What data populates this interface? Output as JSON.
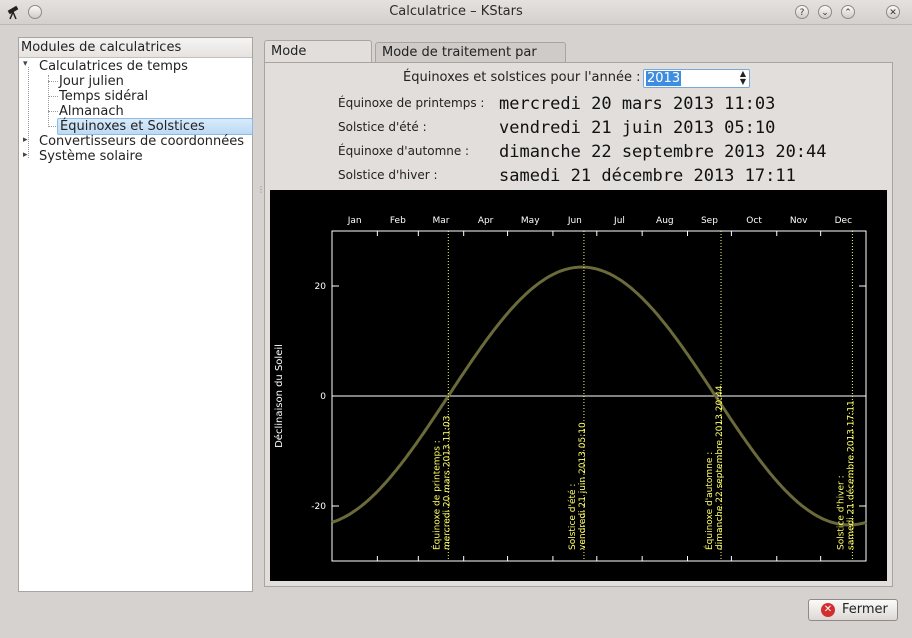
{
  "window": {
    "title": "Calculatrice – KStars",
    "buttons": {
      "help": "?",
      "minimize": "⌄",
      "maximize": "⌃",
      "close": "✕"
    }
  },
  "left_panel": {
    "header": "Modules de calculatrices",
    "tree": {
      "time_group": "Calculatrices de temps",
      "julian": "Jour julien",
      "sidereal": "Temps sidéral",
      "almanac": "Almanach",
      "equinox": "Équinoxes et Solstices",
      "coord_group": "Convertisseurs de coordonnées",
      "solar_group": "Système solaire"
    }
  },
  "tabs": {
    "interactive": "Mode interactif",
    "batch": "Mode de traitement par lots"
  },
  "form": {
    "year_label": "Équinoxes et solstices pour l'année :",
    "year_value": "2013",
    "rows": [
      {
        "label": "Équinoxe de printemps :",
        "value": "mercredi 20 mars 2013 11:03"
      },
      {
        "label": "Solstice d'été :",
        "value": "vendredi 21 juin 2013 05:10"
      },
      {
        "label": "Équinoxe d'automne :",
        "value": "dimanche 22 septembre 2013 20:44"
      },
      {
        "label": "Solstice d'hiver :",
        "value": "samedi 21 décembre 2013 17:11"
      }
    ]
  },
  "chart_data": {
    "type": "line",
    "title": "",
    "xlabel": "",
    "ylabel": "Déclinaison du Soleil",
    "month_labels": [
      "Jan",
      "Feb",
      "Mar",
      "Apr",
      "May",
      "Jun",
      "Jul",
      "Aug",
      "Sep",
      "Oct",
      "Nov",
      "Dec"
    ],
    "xlim": [
      0,
      365
    ],
    "ylim": [
      -30,
      30
    ],
    "yticks": [
      -20,
      0,
      20
    ],
    "series": [
      {
        "amplitude": 23.44,
        "color": "#6b6a3a"
      }
    ],
    "markers": [
      {
        "day": 79.5,
        "label1": "Équinoxe de printemps :",
        "label2": "mercredi 20 mars 2013 11:03"
      },
      {
        "day": 172.2,
        "label1": "Solstice d'été :",
        "label2": "vendredi 21 juin 2013 05:10"
      },
      {
        "day": 265.9,
        "label1": "Équinoxe d'automne :",
        "label2": "dimanche 22 septembre 2013 20:44"
      },
      {
        "day": 355.7,
        "label1": "Solstice d'hiver :",
        "label2": "samedi 21 décembre 2013 17:11"
      }
    ],
    "colors": {
      "background": "#000000",
      "axes": "#ffffff",
      "curve": "#6b6a3a",
      "marker": "#ffff66"
    }
  },
  "footer": {
    "close": "Fermer"
  }
}
